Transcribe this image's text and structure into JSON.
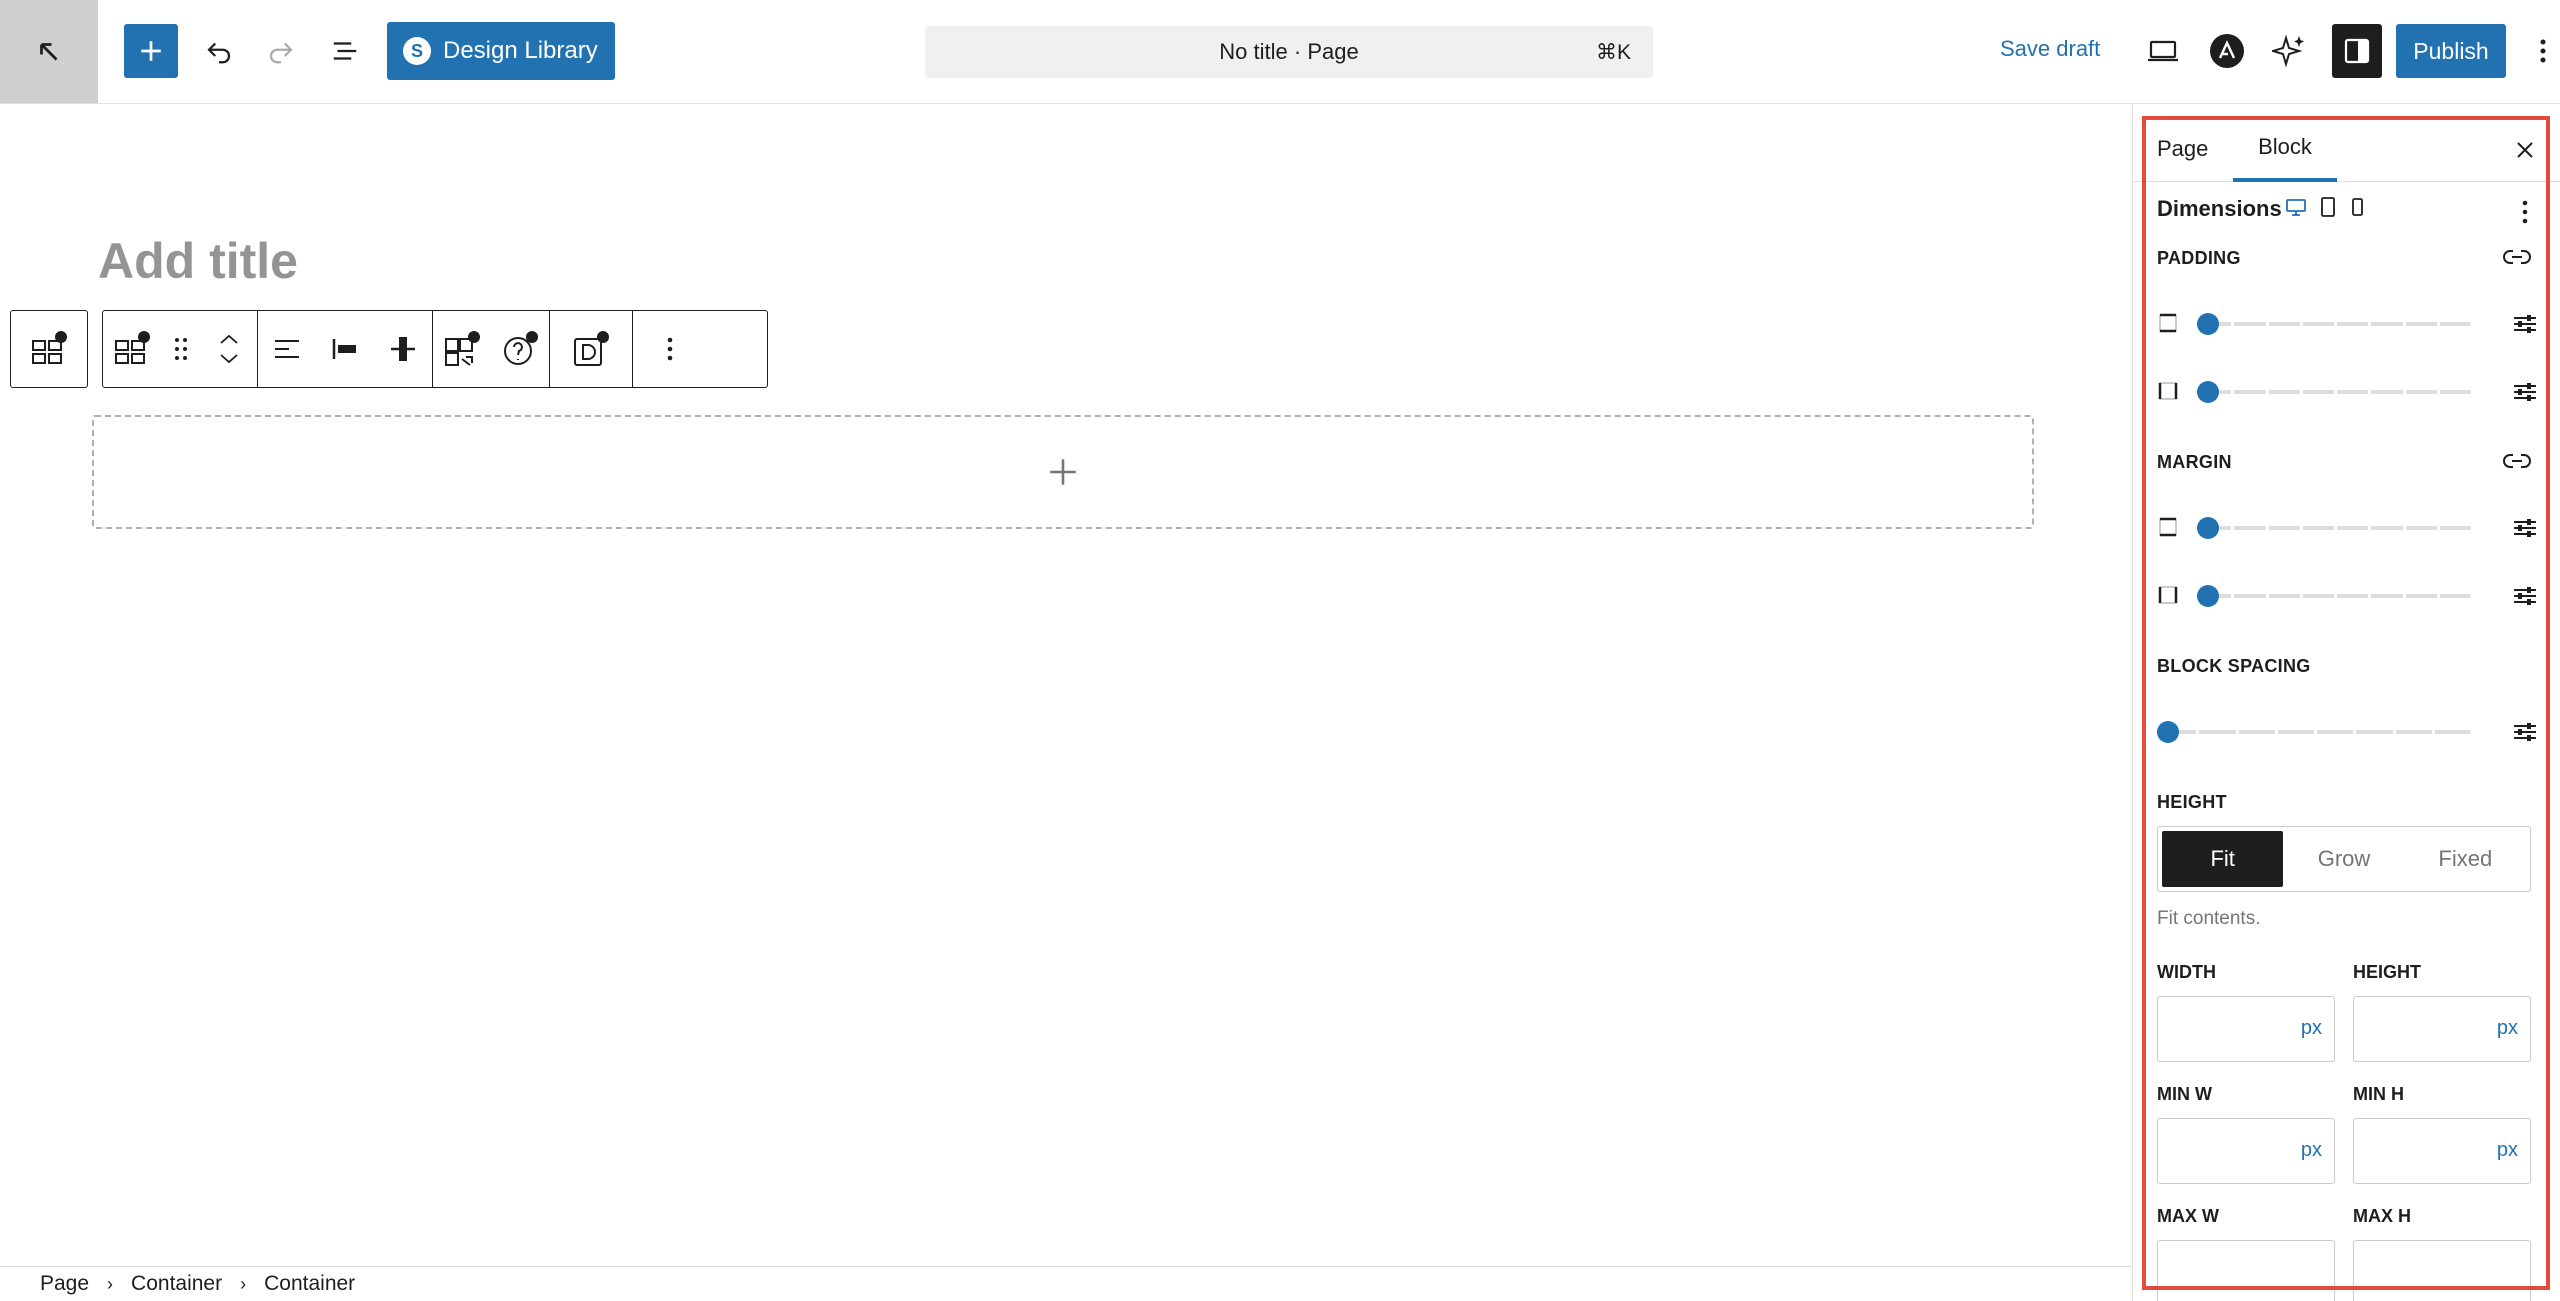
{
  "header": {
    "design_library_label": "Design Library",
    "command_bar_text": "No title · Page",
    "command_shortcut": "⌘K",
    "save_draft_label": "Save draft",
    "publish_label": "Publish",
    "icons": [
      "wordpress-back-icon",
      "plus-icon",
      "undo-icon",
      "redo-icon",
      "document-overview-icon",
      "stackable-logo-icon",
      "desktop-preview-icon",
      "astra-icon",
      "ai-sparkle-icon",
      "sidebar-settings-icon",
      "more-vertical-icon"
    ]
  },
  "editor": {
    "title_placeholder": "Add title"
  },
  "breadcrumb": {
    "items": [
      "Page",
      "Container",
      "Container"
    ]
  },
  "sidebar": {
    "tabs": [
      "Page",
      "Block"
    ],
    "active_tab": "Block",
    "panel_title": "Dimensions",
    "padding_label": "PADDING",
    "margin_label": "MARGIN",
    "block_spacing_label": "BLOCK SPACING",
    "height_label": "HEIGHT",
    "height_options": [
      "Fit",
      "Grow",
      "Fixed"
    ],
    "height_selected": "Fit",
    "height_help": "Fit contents.",
    "sliders": {
      "padding_vertical": 0,
      "padding_horizontal": 0,
      "margin_vertical": 0,
      "margin_horizontal": 0,
      "block_spacing": 0
    },
    "fields": {
      "width_label": "WIDTH",
      "height_label": "HEIGHT",
      "min_w_label": "MIN W",
      "min_h_label": "MIN H",
      "max_w_label": "MAX W",
      "max_h_label": "MAX H",
      "unit": "px",
      "width_value": "",
      "height_value": "",
      "min_w_value": "",
      "min_h_value": ""
    }
  },
  "colors": {
    "accent": "#2271b1",
    "highlight_border": "#e34c3a",
    "dark": "#1e1e1e"
  }
}
